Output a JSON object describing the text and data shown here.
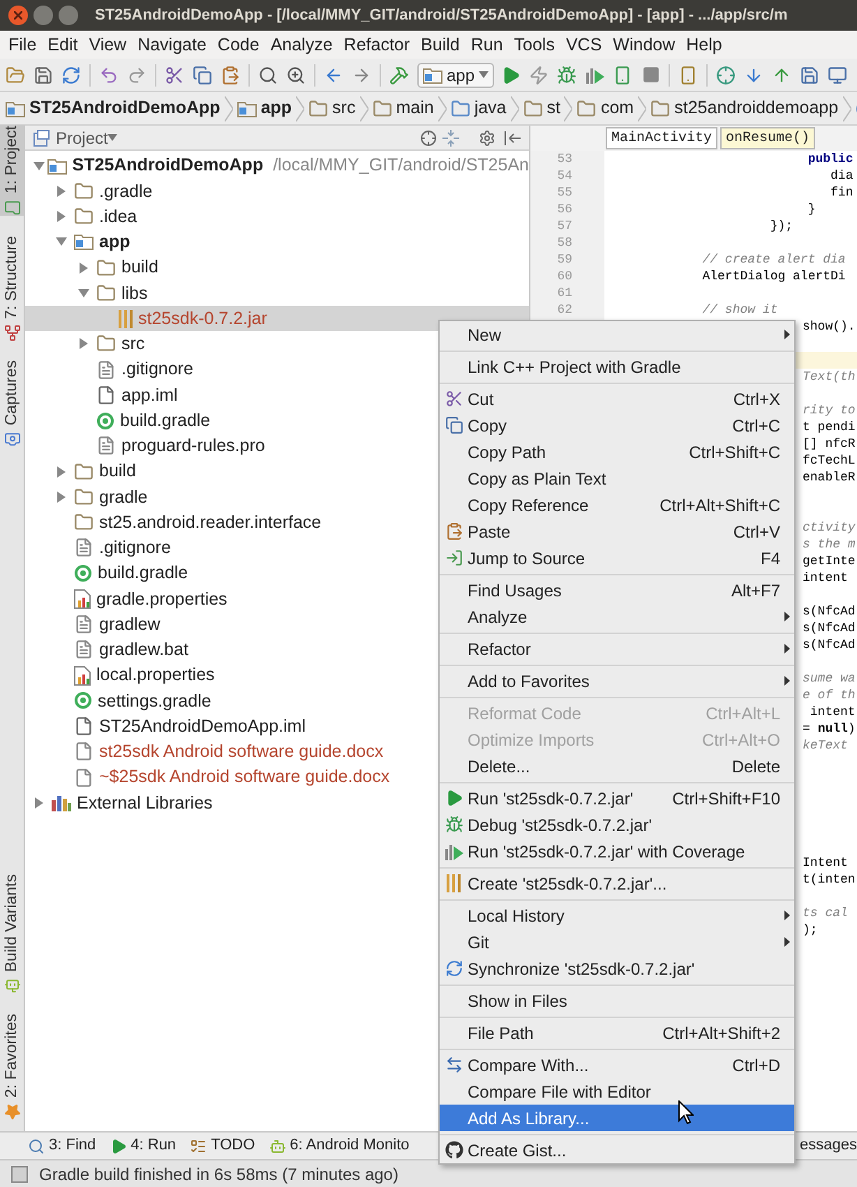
{
  "window": {
    "title": "ST25AndroidDemoApp - [/local/MMY_GIT/android/ST25AndroidDemoApp] - [app] - .../app/src/m"
  },
  "menu_bar": [
    "File",
    "Edit",
    "View",
    "Navigate",
    "Code",
    "Analyze",
    "Refactor",
    "Build",
    "Run",
    "Tools",
    "VCS",
    "Window",
    "Help"
  ],
  "toolbar": {
    "run_config": "app"
  },
  "breadcrumb": [
    {
      "label": "ST25AndroidDemoApp",
      "kind": "module"
    },
    {
      "label": "app",
      "kind": "module"
    },
    {
      "label": "src",
      "kind": "folder"
    },
    {
      "label": "main",
      "kind": "folder"
    },
    {
      "label": "java",
      "kind": "source_root"
    },
    {
      "label": "st",
      "kind": "package"
    },
    {
      "label": "com",
      "kind": "package"
    },
    {
      "label": "st25androiddemoapp",
      "kind": "package"
    }
  ],
  "left_tool_windows": [
    {
      "label": "1: Project",
      "selected": true
    },
    {
      "label": "7: Structure",
      "selected": false
    },
    {
      "label": "Captures",
      "selected": false
    }
  ],
  "left_tool_windows_bottom": [
    {
      "label": "Build Variants",
      "selected": false
    },
    {
      "label": "2: Favorites",
      "selected": false
    }
  ],
  "project": {
    "title": "Project",
    "tree": [
      {
        "label": "ST25AndroidDemoApp",
        "path": "/local/MMY_GIT/android/ST25An",
        "kind": "module",
        "expanded": true,
        "selected": false,
        "untracked": false,
        "children": [
          {
            "label": ".gradle",
            "kind": "folder",
            "expanded": false,
            "selected": false,
            "untracked": false
          },
          {
            "label": ".idea",
            "kind": "folder",
            "expanded": false,
            "selected": false,
            "untracked": false
          },
          {
            "label": "app",
            "kind": "module",
            "expanded": true,
            "selected": false,
            "untracked": false,
            "children": [
              {
                "label": "build",
                "kind": "folder",
                "expanded": false,
                "selected": false,
                "untracked": false
              },
              {
                "label": "libs",
                "kind": "folder",
                "expanded": true,
                "selected": false,
                "untracked": false,
                "children": [
                  {
                    "label": "st25sdk-0.7.2.jar",
                    "kind": "jar",
                    "selected": true,
                    "untracked": true
                  }
                ]
              },
              {
                "label": "src",
                "kind": "folder",
                "expanded": false,
                "selected": false,
                "untracked": false
              },
              {
                "label": ".gitignore",
                "kind": "text",
                "selected": false,
                "untracked": false
              },
              {
                "label": "app.iml",
                "kind": "iml",
                "selected": false,
                "untracked": false
              },
              {
                "label": "build.gradle",
                "kind": "gradle",
                "selected": false,
                "untracked": false
              },
              {
                "label": "proguard-rules.pro",
                "kind": "text",
                "selected": false,
                "untracked": false
              }
            ]
          },
          {
            "label": "build",
            "kind": "folder",
            "expanded": false,
            "selected": false,
            "untracked": false
          },
          {
            "label": "gradle",
            "kind": "folder",
            "expanded": false,
            "selected": false,
            "untracked": false
          },
          {
            "label": "st25.android.reader.interface",
            "kind": "folder",
            "selected": false,
            "untracked": false
          },
          {
            "label": ".gitignore",
            "kind": "text",
            "selected": false,
            "untracked": false
          },
          {
            "label": "build.gradle",
            "kind": "gradle",
            "selected": false,
            "untracked": false
          },
          {
            "label": "gradle.properties",
            "kind": "properties",
            "selected": false,
            "untracked": false
          },
          {
            "label": "gradlew",
            "kind": "text",
            "selected": false,
            "untracked": false
          },
          {
            "label": "gradlew.bat",
            "kind": "text",
            "selected": false,
            "untracked": false
          },
          {
            "label": "local.properties",
            "kind": "properties",
            "selected": false,
            "untracked": false
          },
          {
            "label": "settings.gradle",
            "kind": "gradle",
            "selected": false,
            "untracked": false
          },
          {
            "label": "ST25AndroidDemoApp.iml",
            "kind": "iml",
            "selected": false,
            "untracked": false
          },
          {
            "label": "st25sdk Android software guide.docx",
            "kind": "doc",
            "selected": false,
            "untracked": true
          },
          {
            "label": "~$25sdk Android software guide.docx",
            "kind": "doc",
            "selected": false,
            "untracked": true
          }
        ]
      },
      {
        "label": "External Libraries",
        "kind": "libraries",
        "expanded": false,
        "selected": false,
        "untracked": false
      }
    ]
  },
  "editor": {
    "nav": [
      {
        "label": "MainActivity",
        "selected": false
      },
      {
        "label": "onResume()",
        "selected": true
      }
    ],
    "lines": [
      {
        "number": "53",
        "kind": "keyword",
        "text": "                           public"
      },
      {
        "number": "54",
        "kind": "code",
        "text": "                              dia"
      },
      {
        "number": "55",
        "kind": "code",
        "text": "                              fin"
      },
      {
        "number": "56",
        "kind": "code",
        "text": "                           }"
      },
      {
        "number": "57",
        "kind": "code",
        "text": "                      });"
      },
      {
        "number": "58",
        "kind": "blank"
      },
      {
        "number": "59",
        "kind": "comment",
        "text": "             // create alert dia"
      },
      {
        "number": "60",
        "kind": "code",
        "text": "             AlertDialog alertDi"
      },
      {
        "number": "61",
        "kind": "blank"
      },
      {
        "number": "62",
        "kind": "comment",
        "text": "             // show it"
      }
    ],
    "fragments": [
      {
        "kind": "code",
        "text": "show()."
      },
      {
        "kind": "blank"
      },
      {
        "kind": "caret_line"
      },
      {
        "kind": "comment",
        "text": "Text(th"
      },
      {
        "kind": "blank"
      },
      {
        "kind": "comment",
        "text": "rity to"
      },
      {
        "kind": "code",
        "text": "t pendi"
      },
      {
        "kind": "code",
        "text": "[] nfcR"
      },
      {
        "kind": "code",
        "text": "fcTechL"
      },
      {
        "kind": "code",
        "text": "enableR"
      },
      {
        "kind": "blank"
      },
      {
        "kind": "blank"
      },
      {
        "kind": "comment",
        "text": "ctivity"
      },
      {
        "kind": "comment",
        "text": "s the m"
      },
      {
        "kind": "code",
        "text": "getInte"
      },
      {
        "kind": "code",
        "text": "intent"
      },
      {
        "kind": "blank"
      },
      {
        "kind": "code",
        "text": "s(NfcAd"
      },
      {
        "kind": "code",
        "text": "s(NfcAd"
      },
      {
        "kind": "code",
        "text": "s(NfcAd"
      },
      {
        "kind": "blank"
      },
      {
        "kind": "comment",
        "text": "sume wa"
      },
      {
        "kind": "comment",
        "text": "e of th"
      },
      {
        "kind": "code",
        "text": " intent"
      },
      {
        "kind": "code",
        "text": "= **null**)"
      },
      {
        "kind": "comment",
        "text": "keText"
      },
      {
        "kind": "blank"
      },
      {
        "kind": "blank"
      },
      {
        "kind": "blank"
      },
      {
        "kind": "blank"
      },
      {
        "kind": "blank"
      },
      {
        "kind": "blank"
      },
      {
        "kind": "code",
        "text": "Intent"
      },
      {
        "kind": "code",
        "text": "t(inten"
      },
      {
        "kind": "blank"
      },
      {
        "kind": "comment",
        "text": "ts cal"
      },
      {
        "kind": "code",
        "text": ");"
      }
    ]
  },
  "context_menu": {
    "items": [
      {
        "kind": "item",
        "label": "New",
        "submenu": true,
        "disabled": false,
        "selected": false
      },
      {
        "kind": "separator"
      },
      {
        "kind": "item",
        "label": "Link C++ Project with Gradle",
        "submenu": false,
        "disabled": false,
        "selected": false
      },
      {
        "kind": "separator"
      },
      {
        "kind": "item",
        "label": "Cut",
        "shortcut": "Ctrl+X",
        "submenu": false,
        "disabled": false,
        "selected": false
      },
      {
        "kind": "item",
        "label": "Copy",
        "shortcut": "Ctrl+C",
        "submenu": false,
        "disabled": false,
        "selected": false
      },
      {
        "kind": "item",
        "label": "Copy Path",
        "shortcut": "Ctrl+Shift+C",
        "submenu": false,
        "disabled": false,
        "selected": false
      },
      {
        "kind": "item",
        "label": "Copy as Plain Text",
        "submenu": false,
        "disabled": false,
        "selected": false
      },
      {
        "kind": "item",
        "label": "Copy Reference",
        "shortcut": "Ctrl+Alt+Shift+C",
        "submenu": false,
        "disabled": false,
        "selected": false
      },
      {
        "kind": "item",
        "label": "Paste",
        "shortcut": "Ctrl+V",
        "submenu": false,
        "disabled": false,
        "selected": false
      },
      {
        "kind": "item",
        "label": "Jump to Source",
        "shortcut": "F4",
        "submenu": false,
        "disabled": false,
        "selected": false
      },
      {
        "kind": "separator"
      },
      {
        "kind": "item",
        "label": "Find Usages",
        "shortcut": "Alt+F7",
        "submenu": false,
        "disabled": false,
        "selected": false
      },
      {
        "kind": "item",
        "label": "Analyze",
        "submenu": true,
        "disabled": false,
        "selected": false
      },
      {
        "kind": "separator"
      },
      {
        "kind": "item",
        "label": "Refactor",
        "submenu": true,
        "disabled": false,
        "selected": false
      },
      {
        "kind": "separator"
      },
      {
        "kind": "item",
        "label": "Add to Favorites",
        "submenu": true,
        "disabled": false,
        "selected": false
      },
      {
        "kind": "separator"
      },
      {
        "kind": "item",
        "label": "Reformat Code",
        "shortcut": "Ctrl+Alt+L",
        "submenu": false,
        "disabled": true,
        "selected": false
      },
      {
        "kind": "item",
        "label": "Optimize Imports",
        "shortcut": "Ctrl+Alt+O",
        "submenu": false,
        "disabled": true,
        "selected": false
      },
      {
        "kind": "item",
        "label": "Delete...",
        "shortcut": "Delete",
        "submenu": false,
        "disabled": false,
        "selected": false
      },
      {
        "kind": "separator"
      },
      {
        "kind": "item",
        "label": "Run 'st25sdk-0.7.2.jar'",
        "shortcut": "Ctrl+Shift+F10",
        "submenu": false,
        "disabled": false,
        "selected": false
      },
      {
        "kind": "item",
        "label": "Debug 'st25sdk-0.7.2.jar'",
        "submenu": false,
        "disabled": false,
        "selected": false
      },
      {
        "kind": "item",
        "label": "Run 'st25sdk-0.7.2.jar' with Coverage",
        "submenu": false,
        "disabled": false,
        "selected": false
      },
      {
        "kind": "separator"
      },
      {
        "kind": "item",
        "label": "Create 'st25sdk-0.7.2.jar'...",
        "submenu": false,
        "disabled": false,
        "selected": false
      },
      {
        "kind": "separator"
      },
      {
        "kind": "item",
        "label": "Local History",
        "submenu": true,
        "disabled": false,
        "selected": false
      },
      {
        "kind": "item",
        "label": "Git",
        "submenu": true,
        "disabled": false,
        "selected": false
      },
      {
        "kind": "item",
        "label": "Synchronize 'st25sdk-0.7.2.jar'",
        "submenu": false,
        "disabled": false,
        "selected": false
      },
      {
        "kind": "separator"
      },
      {
        "kind": "item",
        "label": "Show in Files",
        "submenu": false,
        "disabled": false,
        "selected": false
      },
      {
        "kind": "separator"
      },
      {
        "kind": "item",
        "label": "File Path",
        "shortcut": "Ctrl+Alt+Shift+2",
        "submenu": false,
        "disabled": false,
        "selected": false
      },
      {
        "kind": "separator"
      },
      {
        "kind": "item",
        "label": "Compare With...",
        "shortcut": "Ctrl+D",
        "submenu": false,
        "disabled": false,
        "selected": false
      },
      {
        "kind": "item",
        "label": "Compare File with Editor",
        "submenu": false,
        "disabled": false,
        "selected": false
      },
      {
        "kind": "item",
        "label": "Add As Library...",
        "submenu": false,
        "disabled": false,
        "selected": true
      },
      {
        "kind": "separator"
      },
      {
        "kind": "item",
        "label": "Create Gist...",
        "submenu": false,
        "disabled": false,
        "selected": false
      }
    ]
  },
  "bottom_tool_windows": [
    {
      "label": "3: Find"
    },
    {
      "label": "4: Run"
    },
    {
      "label": "TODO"
    },
    {
      "label": "6: Android Monito"
    },
    {
      "label": "essages"
    }
  ],
  "status_bar": {
    "message": "Gradle build finished in 6s 58ms (7 minutes ago)"
  }
}
